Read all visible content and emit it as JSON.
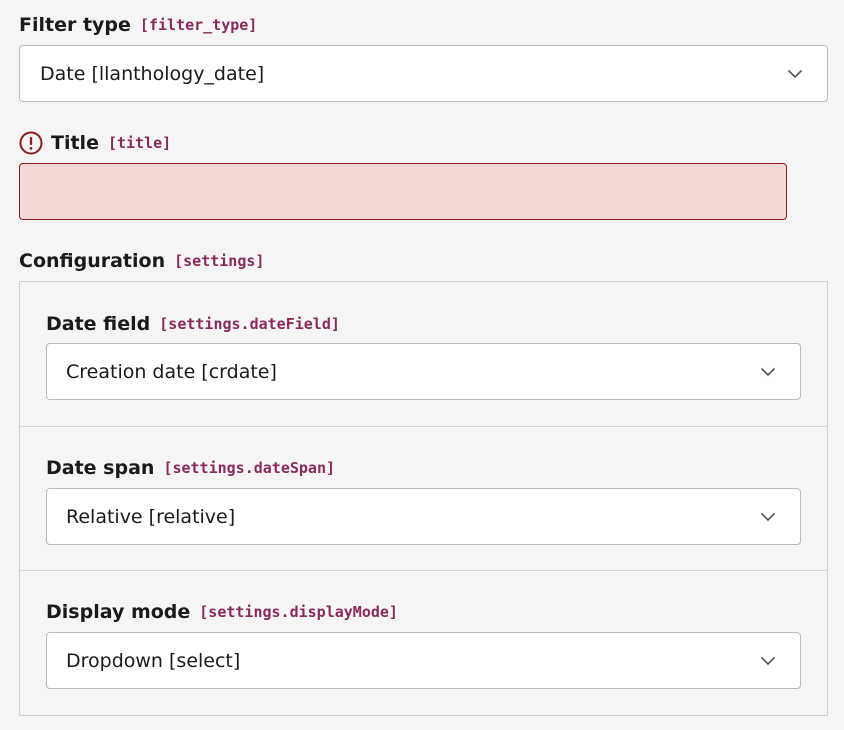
{
  "filter_type": {
    "label": "Filter type",
    "key": "[filter_type]",
    "value": "Date [llanthology_date]"
  },
  "title": {
    "label": "Title",
    "key": "[title]",
    "value": ""
  },
  "configuration": {
    "label": "Configuration",
    "key": "[settings]",
    "date_field": {
      "label": "Date field",
      "key": "[settings.dateField]",
      "value": "Creation date [crdate]"
    },
    "date_span": {
      "label": "Date span",
      "key": "[settings.dateSpan]",
      "value": "Relative [relative]"
    },
    "display_mode": {
      "label": "Display mode",
      "key": "[settings.displayMode]",
      "value": "Dropdown [select]"
    }
  },
  "colors": {
    "code": "#8a2a5c",
    "error": "#8a1f1f",
    "error_bg": "#f2d9d6"
  },
  "icons": {
    "error": "exclamation-circle-icon",
    "dropdown": "chevron-down-icon"
  }
}
